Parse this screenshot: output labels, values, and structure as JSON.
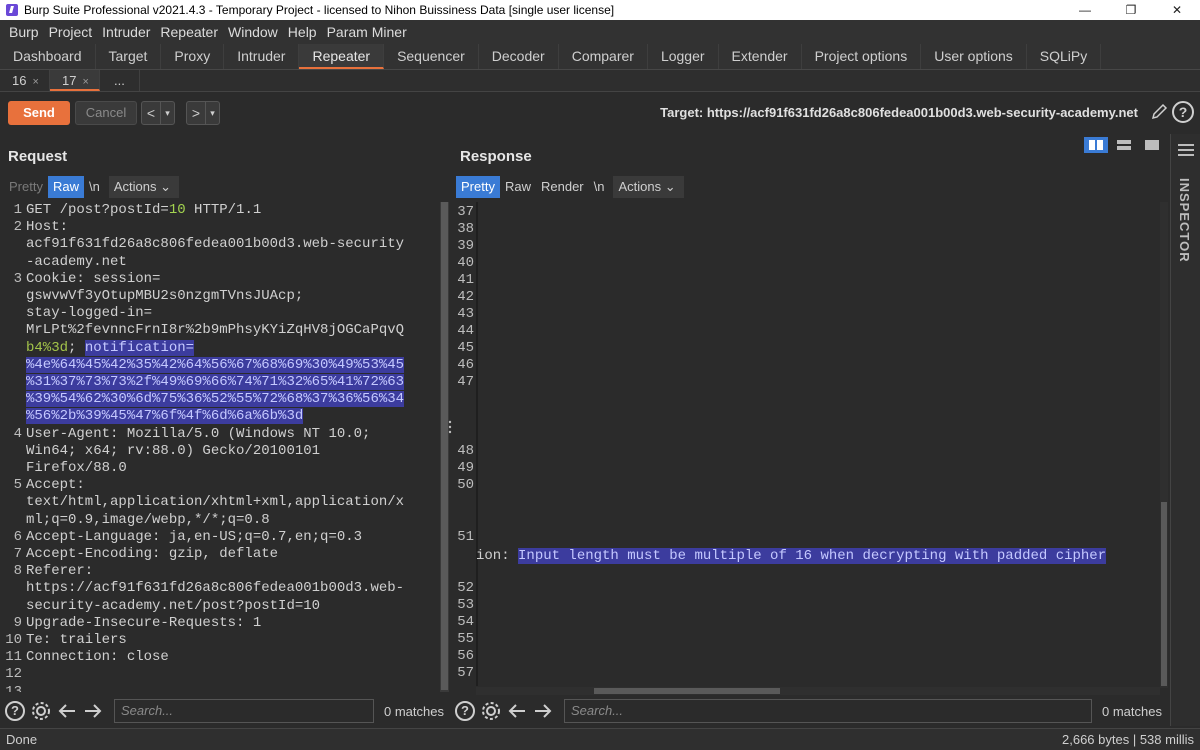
{
  "window": {
    "title": "Burp Suite Professional v2021.4.3 - Temporary Project - licensed to Nihon Buissiness Data [single user license]",
    "controls": [
      "—",
      "❐",
      "✕"
    ]
  },
  "menu": [
    "Burp",
    "Project",
    "Intruder",
    "Repeater",
    "Window",
    "Help",
    "Param Miner"
  ],
  "main_tabs": [
    "Dashboard",
    "Target",
    "Proxy",
    "Intruder",
    "Repeater",
    "Sequencer",
    "Decoder",
    "Comparer",
    "Logger",
    "Extender",
    "Project options",
    "User options",
    "SQLiPy"
  ],
  "active_main_tab": "Repeater",
  "sub_tabs": [
    {
      "label": "16",
      "close": "×"
    },
    {
      "label": "17",
      "close": "×"
    }
  ],
  "sub_tabs_more": "...",
  "toolbar": {
    "send_label": "Send",
    "cancel_label": "Cancel",
    "back_glyph": "<",
    "forward_glyph": ">",
    "dropdown_glyph": "▾",
    "target_label": "Target: https://acf91f631fd26a8c806fedea001b00d3.web-security-academy.net",
    "help_glyph": "?"
  },
  "request": {
    "title": "Request",
    "tabs": [
      "Pretty",
      "Raw",
      "\\n"
    ],
    "actions_label": "Actions",
    "lines": [
      {
        "n": "1",
        "rows": [
          "GET /post?postId=10 HTTP/1.1"
        ]
      },
      {
        "n": "2",
        "rows": [
          "Host:",
          "acf91f631fd26a8c806fedea001b00d3.web-security",
          "-academy.net"
        ]
      },
      {
        "n": "3",
        "rows": [
          "Cookie: session=",
          "gswvwVf3yOtupMBU2s0nzgmTVnsJUAcp;",
          "stay-logged-in=",
          "MrLPt%2fevnncFrnI8r%2b9mPhsyKYiZqHV8jOGCaPqvQ",
          "b4%3d; notification=",
          "%4e%64%45%42%35%42%64%56%67%68%69%30%49%53%45",
          "%31%37%73%73%2f%49%69%66%74%71%32%65%41%72%63",
          "%39%54%62%30%6d%75%36%52%55%72%68%37%36%56%34",
          "%56%2b%39%45%47%6f%4f%6d%6a%6b%3d"
        ]
      },
      {
        "n": "4",
        "rows": [
          "User-Agent: Mozilla/5.0 (Windows NT 10.0;",
          "Win64; x64; rv:88.0) Gecko/20100101",
          "Firefox/88.0"
        ]
      },
      {
        "n": "5",
        "rows": [
          "Accept:",
          "text/html,application/xhtml+xml,application/x",
          "ml;q=0.9,image/webp,*/*;q=0.8"
        ]
      },
      {
        "n": "6",
        "rows": [
          "Accept-Language: ja,en-US;q=0.7,en;q=0.3"
        ]
      },
      {
        "n": "7",
        "rows": [
          "Accept-Encoding: gzip, deflate"
        ]
      },
      {
        "n": "8",
        "rows": [
          "Referer:",
          "https://acf91f631fd26a8c806fedea001b00d3.web-",
          "security-academy.net/post?postId=10"
        ]
      },
      {
        "n": "9",
        "rows": [
          "Upgrade-Insecure-Requests: 1"
        ]
      },
      {
        "n": "10",
        "rows": [
          "Te: trailers"
        ]
      },
      {
        "n": "11",
        "rows": [
          "Connection: close"
        ]
      },
      {
        "n": "12",
        "rows": [
          ""
        ]
      },
      {
        "n": "13",
        "rows": [
          ""
        ]
      }
    ],
    "search_placeholder": "Search...",
    "matches": "0 matches"
  },
  "response": {
    "title": "Response",
    "tabs": [
      "Pretty",
      "Raw",
      "Render",
      "\\n"
    ],
    "actions_label": "Actions",
    "line_numbers": [
      "37",
      "38",
      "39",
      "40",
      "41",
      "42",
      "43",
      "44",
      "45",
      "46",
      "47",
      "48",
      "49",
      "50",
      "51",
      "52",
      "53",
      "54",
      "55",
      "56",
      "57"
    ],
    "error_prefix": "ion: ",
    "error_text": "Input length must be multiple of 16 when decrypting with padded cipher",
    "search_placeholder": "Search...",
    "matches": "0 matches"
  },
  "inspector": {
    "label": "INSPECTOR"
  },
  "status": {
    "left": "Done",
    "right": "2,666 bytes | 538 millis"
  },
  "colors": {
    "accent": "#e8713c",
    "selected": "#3a7bd5",
    "highlight": "#3c3c9e",
    "cookie_value": "#a3c44a"
  }
}
